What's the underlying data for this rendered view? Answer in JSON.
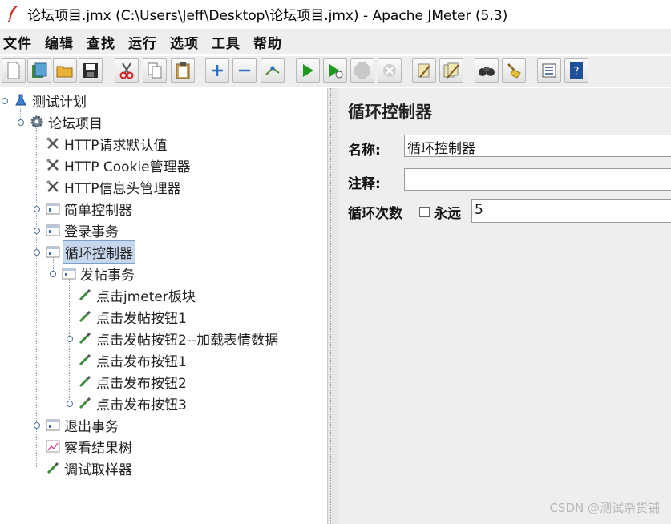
{
  "window": {
    "title": "论坛项目.jmx (C:\\Users\\Jeff\\Desktop\\论坛项目.jmx) - Apache JMeter (5.3)"
  },
  "menu": [
    "文件",
    "编辑",
    "查找",
    "运行",
    "选项",
    "工具",
    "帮助"
  ],
  "toolbar": [
    {
      "name": "new-icon"
    },
    {
      "name": "templates-icon"
    },
    {
      "name": "open-icon"
    },
    {
      "name": "save-icon"
    },
    {
      "name": "cut-icon"
    },
    {
      "name": "copy-icon"
    },
    {
      "name": "paste-icon"
    },
    {
      "name": "expand-icon"
    },
    {
      "name": "collapse-icon"
    },
    {
      "name": "toggle-icon"
    },
    {
      "name": "start-icon"
    },
    {
      "name": "start-no-pause-icon"
    },
    {
      "name": "stop-icon"
    },
    {
      "name": "shutdown-icon"
    },
    {
      "name": "clear-icon"
    },
    {
      "name": "clear-all-icon"
    },
    {
      "name": "search-icon"
    },
    {
      "name": "reset-search-icon"
    },
    {
      "name": "function-helper-icon"
    },
    {
      "name": "help-icon"
    }
  ],
  "tree": [
    {
      "label": "测试计划",
      "type": "testplan"
    },
    {
      "label": "论坛项目",
      "type": "threadgroup"
    },
    {
      "label": "HTTP请求默认值",
      "type": "config"
    },
    {
      "label": "HTTP Cookie管理器",
      "type": "config"
    },
    {
      "label": "HTTP信息头管理器",
      "type": "config"
    },
    {
      "label": "简单控制器",
      "type": "controller"
    },
    {
      "label": "登录事务",
      "type": "controller"
    },
    {
      "label": "循环控制器",
      "type": "controller"
    },
    {
      "label": "发帖事务",
      "type": "controller"
    },
    {
      "label": "点击jmeter板块",
      "type": "sampler"
    },
    {
      "label": "点击发帖按钮1",
      "type": "sampler"
    },
    {
      "label": "点击发帖按钮2--加载表情数据",
      "type": "sampler"
    },
    {
      "label": "点击发布按钮1",
      "type": "sampler"
    },
    {
      "label": "点击发布按钮2",
      "type": "sampler"
    },
    {
      "label": "点击发布按钮3",
      "type": "sampler"
    },
    {
      "label": "退出事务",
      "type": "controller"
    },
    {
      "label": "察看结果树",
      "type": "listener"
    },
    {
      "label": "调试取样器",
      "type": "sampler"
    }
  ],
  "panel": {
    "title": "循环控制器",
    "name_label": "名称:",
    "name_value": "循环控制器",
    "comment_label": "注释:",
    "comment_value": "",
    "loop_label": "循环次数",
    "forever_label": "永远",
    "forever_checked": false,
    "loop_value": "5"
  },
  "watermark": "CSDN @测试杂货铺"
}
